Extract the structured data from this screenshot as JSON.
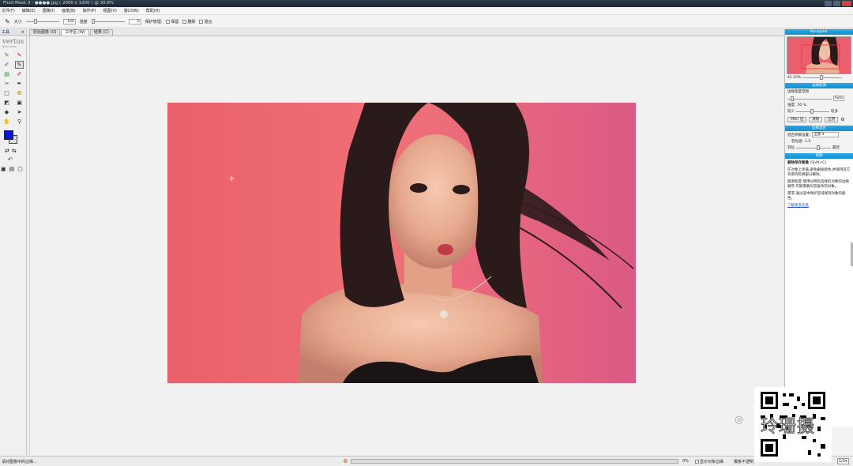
{
  "window": {
    "title": "Fluid Mask 3 - ●●●●.jpg ( 2000 x 1200 ) @ 30.8%"
  },
  "menu": [
    "文件(F)",
    "编辑(E)",
    "图像(I)",
    "画笔(B)",
    "操作(P)",
    "视图(V)",
    "窗口(W)",
    "帮助(H)"
  ],
  "toolbar": {
    "size_label": "大小",
    "size_value": "100",
    "hardness_label": "强度",
    "hardness_value": "0",
    "protect_label": "保护管理:",
    "opt1": "保留",
    "opt2": "删除",
    "opt3": "混合"
  },
  "tools_panel": {
    "title": "工具",
    "logo": "vertus",
    "logo_sub": "fluid mask"
  },
  "tabs": [
    "原始图像 (O)",
    "工作区 (W)",
    "结果 (C)"
  ],
  "active_tab": 1,
  "right": {
    "navigator_title": "Navigator",
    "zoom_value": "41.10%",
    "edge_title": "边缘检测",
    "edge_label": "边缘宽度范围",
    "edge_value": "Auto",
    "edge_max": "50 %",
    "edge_min_label": "较少",
    "edge_max_label": "较多",
    "btn1": "MRU 边",
    "btn2": "清除",
    "btn3": "应用",
    "mask_title": "边缘混合",
    "mask_label": "混合参数设置:",
    "mask_select": "全部",
    "feather_label": "羽化值:",
    "feather_value": "1.5",
    "smooth_label": "羽化",
    "smooth_right": "最佳",
    "help_title": "帮助",
    "help_heading": "删除保存图像",
    "help_heading2": "(Shift+C)",
    "help_p1": "在对象上涂满,避免删除颜色,并保持其它背景的轮廓部分删除。",
    "help_p2": "圆滑程度:使用分明的选择的对象的边缘顺序,可能需要比较复杂的对象。",
    "help_p3": "需求:通过选中保护区域保持对象的颜色。",
    "help_link": "了解更多信息"
  },
  "status": {
    "left": "请对图像中的边缘...",
    "percent": "0%",
    "checkbox_label": "显示对象边缘",
    "mode": "模板不透明",
    "zoom": "1/2"
  },
  "watermark": "玲珊摄"
}
